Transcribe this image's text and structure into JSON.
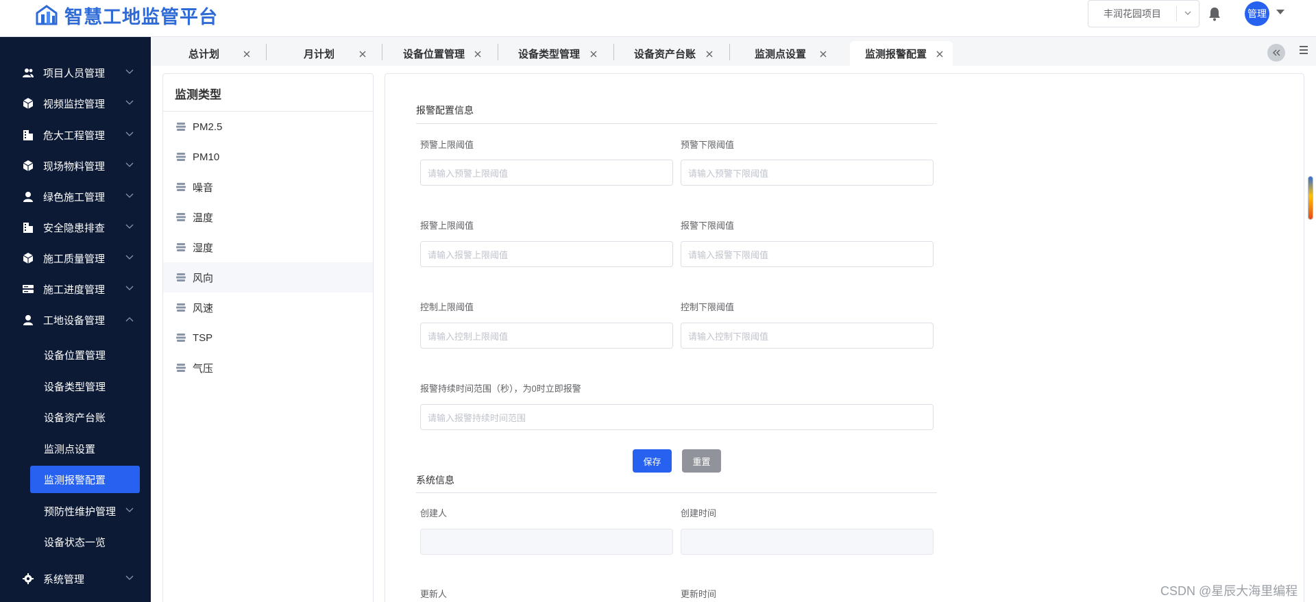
{
  "app": {
    "title": "智慧工地监管平台",
    "brand_color": "#2f6bd6",
    "accent_color": "#2761f0",
    "sidebar_bg": "#0c1a36"
  },
  "header": {
    "project_select_value": "丰润花园项目",
    "user_avatar_label": "管理"
  },
  "sidebar": {
    "items": [
      {
        "label": "项目人员管理",
        "icon": "users-icon"
      },
      {
        "label": "视频监控管理",
        "icon": "cube-icon"
      },
      {
        "label": "危大工程管理",
        "icon": "building-icon"
      },
      {
        "label": "现场物料管理",
        "icon": "cube-icon"
      },
      {
        "label": "绿色施工管理",
        "icon": "user-icon"
      },
      {
        "label": "安全隐患排查",
        "icon": "building-icon"
      },
      {
        "label": "施工质量管理",
        "icon": "cube-icon"
      },
      {
        "label": "施工进度管理",
        "icon": "server-icon"
      },
      {
        "label": "工地设备管理",
        "icon": "user-icon",
        "expanded": true
      }
    ],
    "sub_items": [
      {
        "label": "设备位置管理"
      },
      {
        "label": "设备类型管理"
      },
      {
        "label": "设备资产台账"
      },
      {
        "label": "监测点设置"
      },
      {
        "label": "监测报警配置",
        "active": true
      },
      {
        "label": "预防性维护管理"
      },
      {
        "label": "设备状态一览"
      }
    ],
    "system_item": {
      "label": "系统管理",
      "icon": "gear-icon"
    }
  },
  "tabs": [
    {
      "label": "总计划"
    },
    {
      "label": "月计划"
    },
    {
      "label": "设备位置管理"
    },
    {
      "label": "设备类型管理"
    },
    {
      "label": "设备资产台账"
    },
    {
      "label": "监测点设置"
    },
    {
      "label": "监测报警配置",
      "active": true
    }
  ],
  "type_panel": {
    "title": "监测类型",
    "items": [
      "PM2.5",
      "PM10",
      "噪音",
      "温度",
      "湿度",
      "风向",
      "风速",
      "TSP",
      "气压"
    ],
    "hovered_item": "风向"
  },
  "form": {
    "alarm_section_title": "报警配置信息",
    "fields": {
      "warn_upper": {
        "label": "预警上限阈值",
        "placeholder": "请输入预警上限阈值"
      },
      "warn_lower": {
        "label": "预警下限阈值",
        "placeholder": "请输入预警下限阈值"
      },
      "alarm_upper": {
        "label": "报警上限阈值",
        "placeholder": "请输入报警上限阈值"
      },
      "alarm_lower": {
        "label": "报警下限阈值",
        "placeholder": "请输入报警下限阈值"
      },
      "control_upper": {
        "label": "控制上限阈值",
        "placeholder": "请输入控制上限阈值"
      },
      "control_lower": {
        "label": "控制下限阈值",
        "placeholder": "请输入控制下限阈值"
      },
      "duration": {
        "label": "报警持续时间范围（秒），为0时立即报警",
        "placeholder": "请输入报警持续时间范围"
      }
    },
    "save_label": "保存",
    "reset_label": "重置",
    "system_section_title": "系统信息",
    "system_fields": {
      "creator": {
        "label": "创建人"
      },
      "create_time": {
        "label": "创建时间"
      },
      "updater": {
        "label": "更新人"
      },
      "update_time": {
        "label": "更新时间"
      }
    }
  },
  "watermark": "CSDN @星辰大海里编程"
}
